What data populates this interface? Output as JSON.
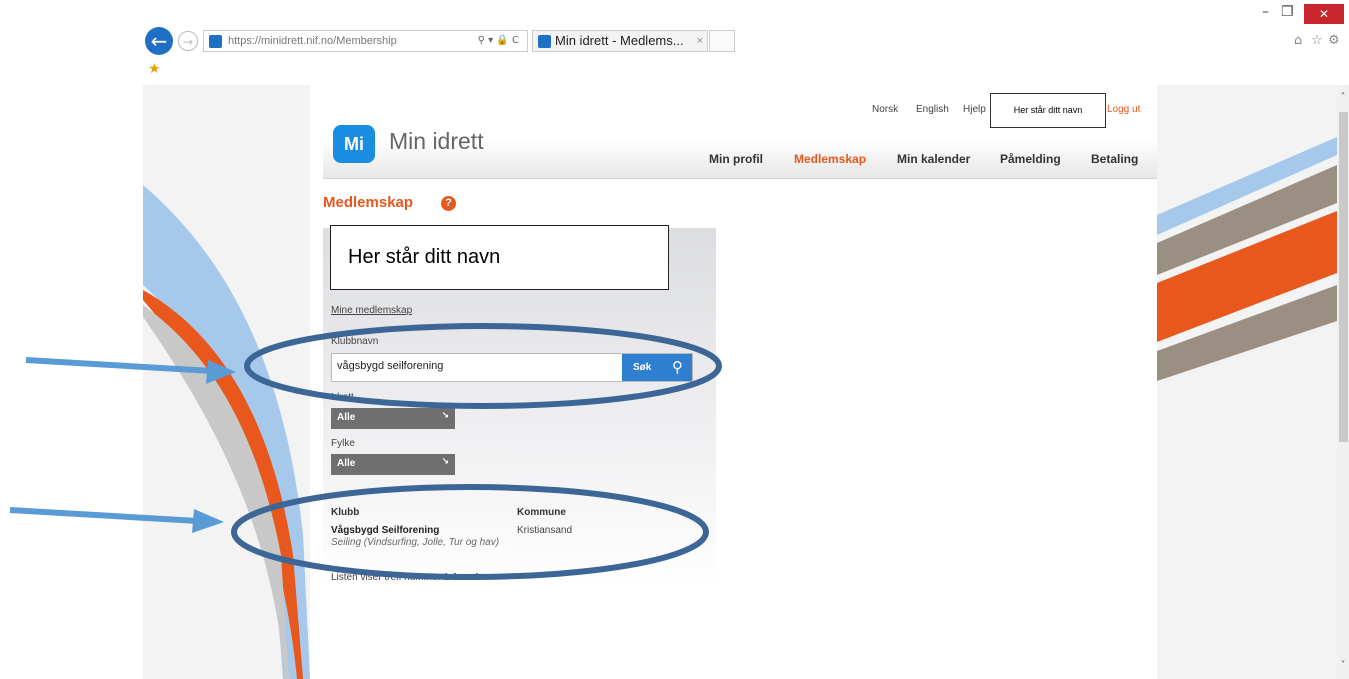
{
  "browser": {
    "address_url": "https://minidrett.nif.no/Membership",
    "tab_title": "Min idrett - Medlems...",
    "tab_close": "×",
    "address_tools": "⚲ ▾ 🔒 C",
    "win_minimize": "–",
    "win_restore": "❐",
    "win_close": "✕",
    "home_icon": "⌂",
    "favorites_icon": "☆",
    "settings_icon": "⚙",
    "favbar_star": "★"
  },
  "header": {
    "lang_norsk": "Norsk",
    "lang_english": "English",
    "help": "Hjelp",
    "user_name": "Her står ditt navn",
    "logout": "Logg ut",
    "logo_badge": "Mi",
    "logo_text": "Min idrett"
  },
  "nav": {
    "items": [
      {
        "label": "Min profil"
      },
      {
        "label": "Medlemskap"
      },
      {
        "label": "Min kalender"
      },
      {
        "label": "Påmelding"
      },
      {
        "label": "Betaling"
      }
    ],
    "active": "Medlemskap"
  },
  "page": {
    "title": "Medlemskap",
    "help_icon": "?"
  },
  "panel": {
    "name_box": "Her står ditt navn",
    "my_memberships_link": "Mine medlemskap",
    "club_name_label": "Klubbnavn",
    "search_value": "vågsbygd seilforening",
    "search_button": "Søk",
    "sport_label": "Idrett",
    "sport_value": "Alle",
    "county_label": "Fylke",
    "county_value": "Alle",
    "results": {
      "headers": [
        "Klubb",
        "Kommune"
      ],
      "rows": [
        {
          "club": "Vågsbygd Seilforening",
          "sports": "Seiling (Vindsurfing, Jolle, Tur og hav)",
          "municipality": "Kristiansand"
        }
      ],
      "footer": "Listen viser treff nummer 1-1 av 1"
    }
  },
  "annotation_color": "#3c6696",
  "arrow_color": "#5b9bd5",
  "accent_color": "#e8571c"
}
